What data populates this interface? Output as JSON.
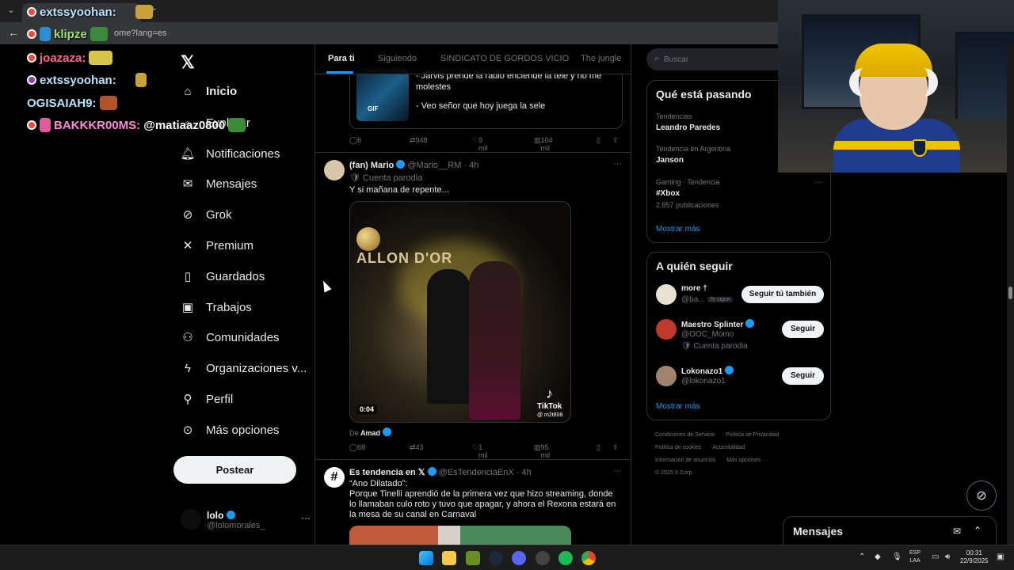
{
  "browser": {
    "url_text": "ome?lang=es"
  },
  "chat": [
    {
      "user": "extssyoohan:"
    },
    {
      "user": "klipze"
    },
    {
      "user": "joazaza:"
    },
    {
      "user": "extssyoohan:"
    },
    {
      "user": "OGISAIAH9:"
    },
    {
      "user": "BAKKKR00MS:",
      "message": "@matiaaz0800"
    }
  ],
  "nav": {
    "items": [
      {
        "label": "Inicio",
        "icon": "home-icon"
      },
      {
        "label": "Explorar",
        "icon": "search-icon"
      },
      {
        "label": "Notificaciones",
        "icon": "bell-icon"
      },
      {
        "label": "Mensajes",
        "icon": "mail-icon"
      },
      {
        "label": "Grok",
        "icon": "grok-icon"
      },
      {
        "label": "Premium",
        "icon": "x-icon"
      },
      {
        "label": "Guardados",
        "icon": "bookmark-icon"
      },
      {
        "label": "Trabajos",
        "icon": "briefcase-icon"
      },
      {
        "label": "Comunidades",
        "icon": "people-icon"
      },
      {
        "label": "Organizaciones v...",
        "icon": "lightning-icon"
      },
      {
        "label": "Perfil",
        "icon": "person-icon"
      },
      {
        "label": "Más opciones",
        "icon": "more-circle-icon"
      }
    ],
    "post_label": "Postear",
    "account": {
      "name": "lolo",
      "handle": "@lolomorales_"
    }
  },
  "feed": {
    "tabs": [
      "Para ti",
      "Siguiendo",
      "SINDICATO DE GORDOS VICIO",
      "The jungle"
    ],
    "first": {
      "gif_label": "GIF",
      "text1": "- Jarvis prende la radio enciende la tele y no me molestes",
      "text2": "- Veo señor que hoy juega la sele",
      "replies": "6",
      "reposts": "948",
      "likes": "9 mil",
      "views": "104 mil"
    },
    "second": {
      "name": "(fan) Mario",
      "handle": "@Mario__RM · 4h",
      "tag": "Cuenta parodia",
      "text": "Y si mañana de repente...",
      "video_brand": "ALLON D'OR",
      "duration": "0:04",
      "tiktok": "TikTok",
      "tiktok_handle": "@ m2t808",
      "from_prefix": "De",
      "from_name": "Amad",
      "replies": "68",
      "reposts": "43",
      "likes": "1 mil",
      "views": "95 mil"
    },
    "third": {
      "name": "Es tendencia en 𝕏",
      "handle": "@EsTendenciaEnX · 4h",
      "text": "“Ano Dilatado”:\nPorque Tinelli aprendió de la primera vez que hizo streaming, donde lo llamaban culo roto y tuvo que apagar, y ahora el Rexona estará en la mesa de su canal en Carnaval"
    }
  },
  "right": {
    "search_placeholder": "Buscar",
    "trends_title": "Qué está pasando",
    "trends": [
      {
        "context": "Tendencias",
        "name": "Leandro Paredes",
        "count": ""
      },
      {
        "context": "Tendencia en Argentina",
        "name": "Janson",
        "count": ""
      },
      {
        "context": "Gaming · Tendencia",
        "name": "#Xbox",
        "count": "2.857 publicaciones"
      }
    ],
    "trends_more": "Mostrar más",
    "follow_title": "A quién seguir",
    "follow": [
      {
        "name": "more †",
        "handle": "@ba...",
        "tag": "Te sigue",
        "sub": "",
        "button": "Seguir tú también"
      },
      {
        "name": "Maestro Splinter",
        "handle": "@OOC_Momo",
        "tag": "",
        "sub": "Cuenta parodia",
        "button": "Seguir"
      },
      {
        "name": "Lokonazo1",
        "handle": "@lokonazo1",
        "tag": "",
        "sub": "",
        "button": "Seguir"
      }
    ],
    "follow_more": "Mostrar más",
    "footer": [
      "Condiciones de Servicio",
      "Política de Privacidad",
      "Política de cookies",
      "Accesibilidad",
      "Información de anuncios",
      "Más opciones ···",
      "© 2025 X Corp."
    ]
  },
  "messages": {
    "title": "Mensajes"
  },
  "taskbar": {
    "lang1": "ESP",
    "lang2": "LAA",
    "time": "00:31",
    "date": "22/9/2025"
  },
  "colors": {
    "accent": "#1d9bf0",
    "background": "#000000"
  }
}
